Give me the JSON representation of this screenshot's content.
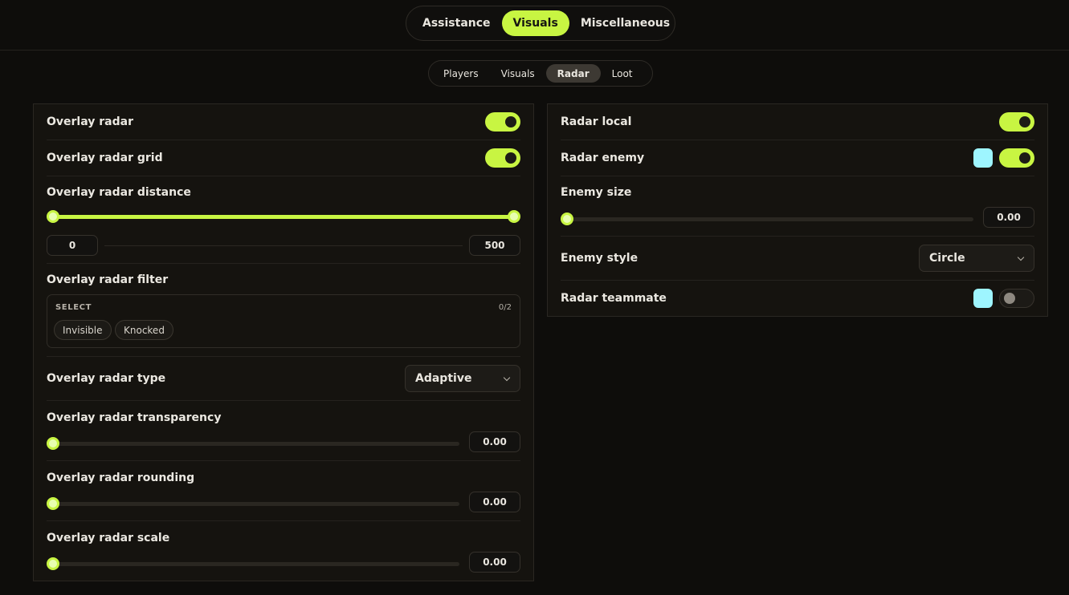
{
  "main_tabs": [
    {
      "label": "Assistance",
      "active": false
    },
    {
      "label": "Visuals",
      "active": true
    },
    {
      "label": "Miscellaneous",
      "active": false
    }
  ],
  "sub_tabs": [
    {
      "label": "Players",
      "active": false
    },
    {
      "label": "Visuals",
      "active": false
    },
    {
      "label": "Radar",
      "active": true
    },
    {
      "label": "Loot",
      "active": false
    }
  ],
  "accent_color": "#c8f542",
  "left": {
    "overlay_radar": {
      "label": "Overlay radar",
      "enabled": true
    },
    "overlay_radar_grid": {
      "label": "Overlay radar grid",
      "enabled": true
    },
    "overlay_radar_distance": {
      "label": "Overlay radar distance",
      "min_value": "0",
      "max_value": "500",
      "fill_fraction": 1.0
    },
    "overlay_radar_filter": {
      "label": "Overlay radar filter",
      "select_label": "SELECT",
      "count": "0/2",
      "options": [
        "Invisible",
        "Knocked"
      ]
    },
    "overlay_radar_type": {
      "label": "Overlay radar type",
      "value": "Adaptive"
    },
    "overlay_radar_transparency": {
      "label": "Overlay radar transparency",
      "value": "0.00",
      "fraction": 0.0
    },
    "overlay_radar_rounding": {
      "label": "Overlay radar rounding",
      "value": "0.00",
      "fraction": 0.0
    },
    "overlay_radar_scale": {
      "label": "Overlay radar scale",
      "value": "0.00",
      "fraction": 0.0
    }
  },
  "right": {
    "radar_local": {
      "label": "Radar local",
      "enabled": true
    },
    "radar_enemy": {
      "label": "Radar enemy",
      "enabled": true,
      "color": "#9ef5ff"
    },
    "enemy_size": {
      "label": "Enemy size",
      "value": "0.00",
      "fraction": 0.0
    },
    "enemy_style": {
      "label": "Enemy style",
      "value": "Circle"
    },
    "radar_teammate": {
      "label": "Radar teammate",
      "enabled": false,
      "color": "#9ef5ff"
    }
  }
}
